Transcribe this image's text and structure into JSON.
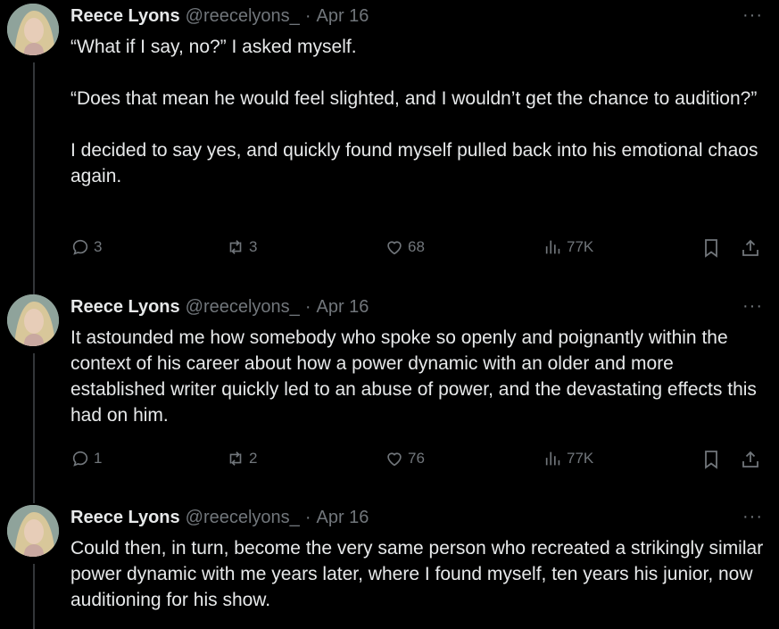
{
  "tweets": [
    {
      "name": "Reece Lyons",
      "handle": "@reecelyons_",
      "sep": "·",
      "date": "Apr 16",
      "more": "···",
      "paragraphs": [
        "“What if I say, no?” I asked myself.",
        "“Does that mean he would feel slighted, and I wouldn’t get the chance to audition?”",
        "I decided to say yes, and quickly found myself pulled back into his emotional chaos again."
      ],
      "replies": "3",
      "reposts": "3",
      "likes": "68",
      "views": "77K"
    },
    {
      "name": "Reece Lyons",
      "handle": "@reecelyons_",
      "sep": "·",
      "date": "Apr 16",
      "more": "···",
      "paragraphs": [
        "It astounded me how somebody who spoke so openly and poignantly within the context of his career about how a power dynamic with an older and more established writer quickly led to an abuse of power, and the devastating effects this had on him."
      ],
      "replies": "1",
      "reposts": "2",
      "likes": "76",
      "views": "77K"
    },
    {
      "name": "Reece Lyons",
      "handle": "@reecelyons_",
      "sep": "·",
      "date": "Apr 16",
      "more": "···",
      "paragraphs": [
        "Could then, in turn, become the very same person who recreated a strikingly similar power dynamic with me years later, where I found myself, ten years his junior, now auditioning for his show."
      ]
    }
  ],
  "icons": {
    "reply": "reply-icon",
    "repost": "repost-icon",
    "like": "heart-icon",
    "views": "views-icon",
    "bookmark": "bookmark-icon",
    "share": "share-icon"
  },
  "colors": {
    "background": "#000000",
    "text": "#e7e9ea",
    "muted": "#71767b",
    "thread_line": "#333639"
  }
}
